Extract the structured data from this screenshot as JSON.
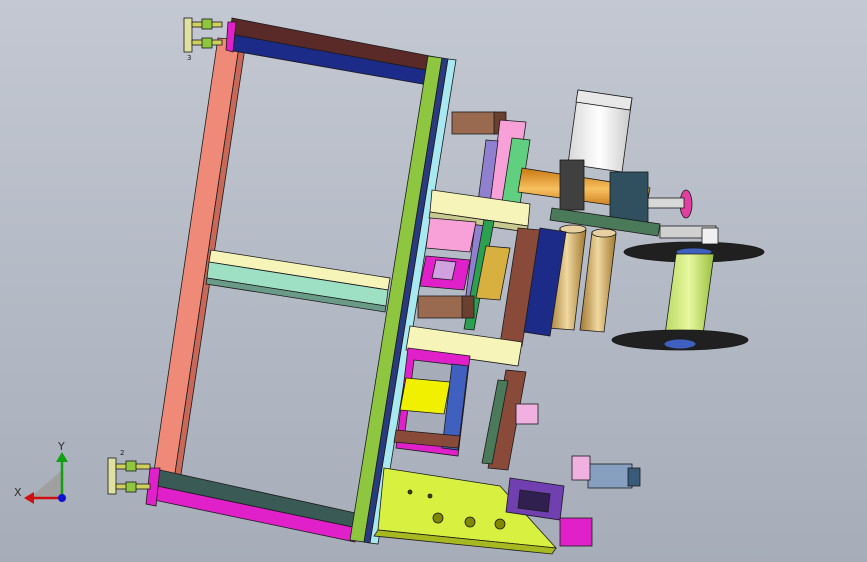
{
  "viewport": {
    "background_top": "#c3c8d2",
    "background_bottom": "#a6adb9"
  },
  "axis_triad": {
    "x_label": "X",
    "y_label": "Y",
    "x_color": "#d01010",
    "y_color": "#10a010",
    "z_color": "#1010d0"
  },
  "part_markers": {
    "top_marker": "3",
    "bottom_marker": "2"
  },
  "colors": {
    "salmon": "#f08a78",
    "dark_maroon": "#5a2a28",
    "navy": "#1c2a88",
    "lime": "#8ec63f",
    "light_cyan": "#a8e8f0",
    "cream": "#f6f4b8",
    "mint": "#9ee0c4",
    "magenta": "#e020c8",
    "yellow": "#f0f000",
    "orange": "#f0a020",
    "white_motor": "#f2f2f2",
    "teal_dark": "#3a5a56",
    "olive": "#cccc30",
    "pale_green": "#d8f0a0",
    "violet": "#9080d0",
    "pink": "#f8a0d8",
    "brown": "#9a6a50",
    "blue_gray": "#88a0c0",
    "black": "#202020",
    "gold": "#d8b040"
  }
}
